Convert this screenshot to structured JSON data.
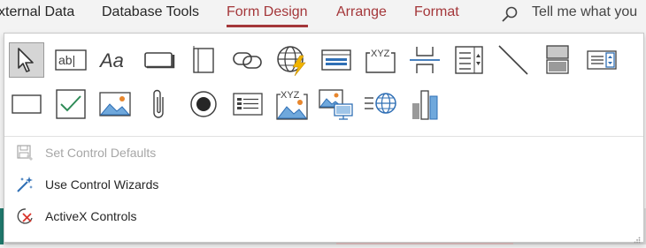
{
  "ribbon": {
    "tabs": [
      {
        "label": "xternal Data"
      },
      {
        "label": "Database Tools"
      },
      {
        "label": "Form Design"
      },
      {
        "label": "Arrange"
      },
      {
        "label": "Format"
      }
    ],
    "tell_me": "Tell me what you"
  },
  "gallery": {
    "row1": [
      {
        "icon": "select-pointer-icon"
      },
      {
        "icon": "text-box-icon",
        "glyph": "ab|"
      },
      {
        "icon": "label-icon",
        "glyph": "Aa"
      },
      {
        "icon": "button-icon"
      },
      {
        "icon": "tab-control-icon"
      },
      {
        "icon": "hyperlink-icon"
      },
      {
        "icon": "web-browser-control-icon"
      },
      {
        "icon": "navigation-control-icon"
      },
      {
        "icon": "option-group-icon",
        "glyph": "XYZ"
      },
      {
        "icon": "insert-page-break-icon"
      },
      {
        "icon": "combo-box-icon"
      },
      {
        "icon": "line-icon"
      },
      {
        "icon": "toggle-button-icon"
      },
      {
        "icon": "list-box-icon"
      }
    ],
    "row2": [
      {
        "icon": "rectangle-icon"
      },
      {
        "icon": "check-box-icon"
      },
      {
        "icon": "image-icon"
      },
      {
        "icon": "attachment-icon"
      },
      {
        "icon": "option-button-icon"
      },
      {
        "icon": "subform-icon"
      },
      {
        "icon": "bound-object-frame-icon",
        "glyph": "XYZ"
      },
      {
        "icon": "unbound-object-frame-icon"
      },
      {
        "icon": "edge-browser-icon"
      },
      {
        "icon": "chart-icon"
      }
    ]
  },
  "menu": {
    "items": [
      {
        "label": "Set Control Defaults",
        "enabled": false,
        "icon": "set-defaults-icon"
      },
      {
        "label": "Use Control Wizards",
        "enabled": true,
        "icon": "wand-icon"
      },
      {
        "label": "ActiveX Controls",
        "enabled": true,
        "icon": "activex-icon"
      }
    ]
  },
  "colors": {
    "accent": "#a4373a",
    "icon_blue": "#2f6fb5",
    "icon_dark": "#404040",
    "check_green": "#2e8b57",
    "lightning": "#f0b400"
  }
}
